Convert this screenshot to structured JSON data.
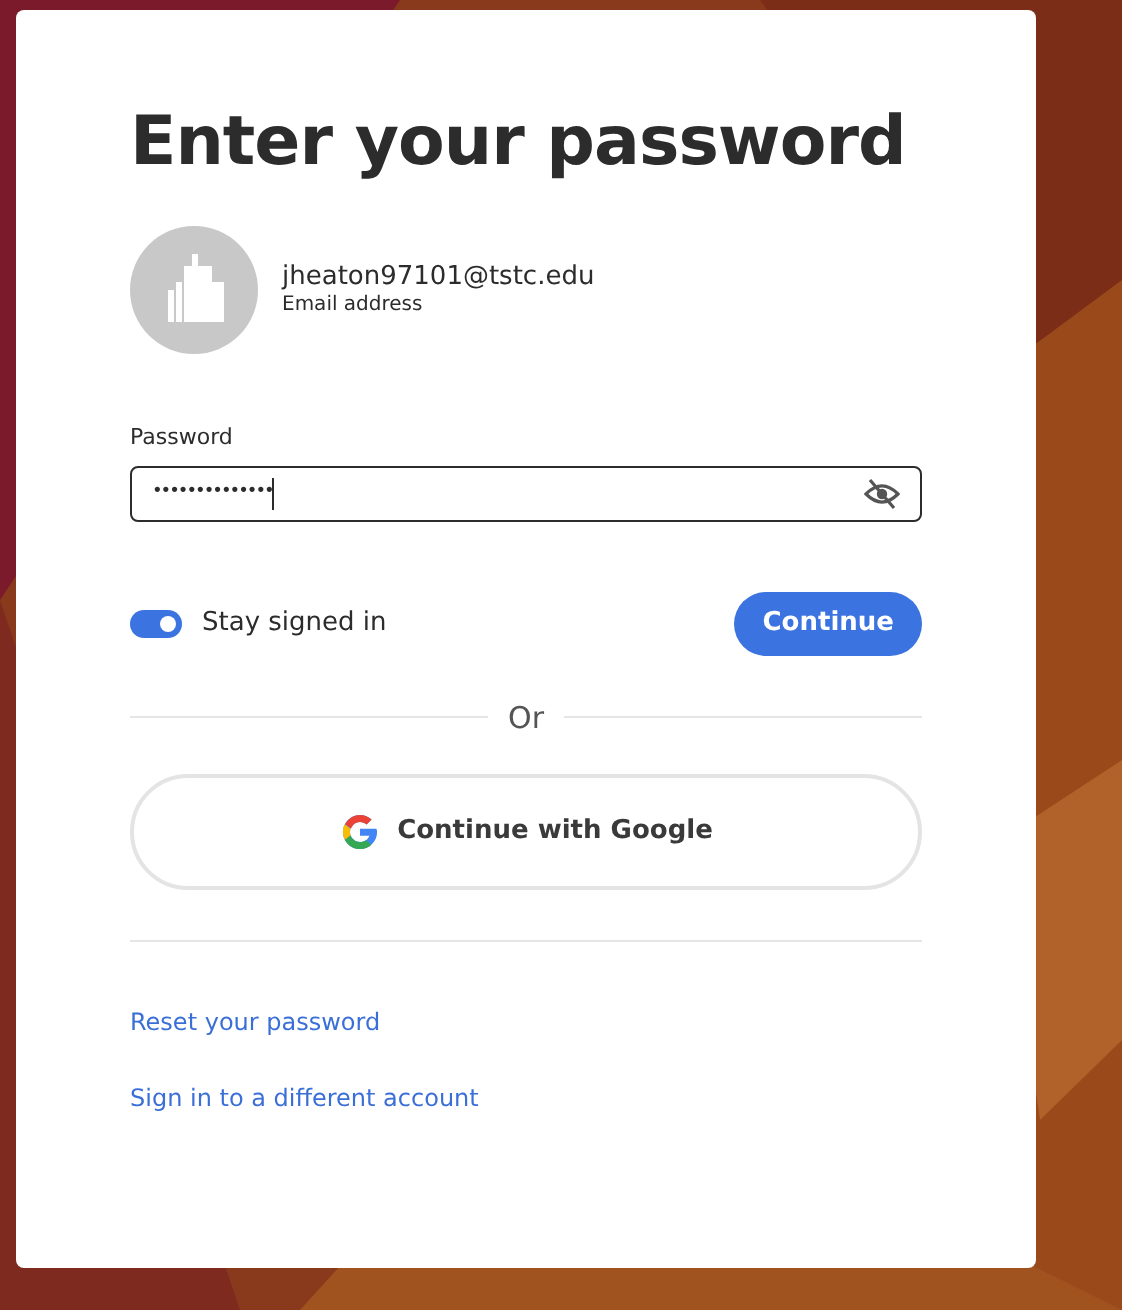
{
  "title": "Enter your password",
  "account": {
    "email": "jheaton97101@tstc.edu",
    "caption": "Email address"
  },
  "password": {
    "label": "Password",
    "value": "••••••••••••••",
    "focused": true
  },
  "stay_signed_in": {
    "label": "Stay signed in",
    "on": true
  },
  "continue_button": "Continue",
  "divider": "Or",
  "google_button": "Continue with Google",
  "links": [
    "Reset your password",
    "Sign in to a different account"
  ]
}
